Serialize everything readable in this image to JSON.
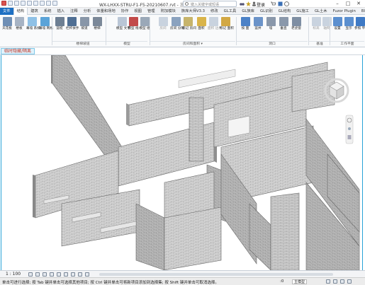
{
  "titlebar": {
    "title": "WX-LHXX-STRU-F1-F5-20210607.rvt - 三维视图: {三维}",
    "search_placeholder": "键入关键字或短语",
    "user": "登录"
  },
  "tabs": [
    "文件",
    "结构",
    "建筑",
    "系统",
    "插入",
    "注释",
    "分析",
    "体量和场地",
    "协作",
    "视图",
    "管理",
    "附加模块",
    "族库大师V3.3",
    "修改",
    "GL工具",
    "GL族库",
    "GL识别",
    "GL结构",
    "GL施工",
    "GL土木",
    "Fuzor Plugin",
    "BIMMAKE"
  ],
  "active_tab": "结构",
  "ribbon": {
    "buttons": [
      {
        "id": "b0",
        "label": "天花板",
        "icon": "ceiling-icon",
        "color": "#6f8fb5"
      },
      {
        "id": "b1",
        "label": "楼板",
        "icon": "floor-icon",
        "color": "#a6b3c4"
      },
      {
        "id": "b2",
        "label": "幕墙 系统",
        "icon": "curtain-system-icon",
        "color": "#8fc1e6"
      },
      {
        "id": "b3",
        "label": "幕墙 网格",
        "icon": "curtain-grid-icon",
        "color": "#5aa3d8"
      },
      {
        "id": "b4",
        "label": "竖梃",
        "icon": "mullion-icon",
        "color": "#6d7f93"
      },
      {
        "id": "b5",
        "label": "栏杆扶手",
        "icon": "railing-icon",
        "color": "#4f6f94"
      },
      {
        "id": "b6",
        "label": "坡道",
        "icon": "ramp-icon",
        "color": "#8896a8"
      },
      {
        "id": "b7",
        "label": "楼梯",
        "icon": "stair-icon",
        "color": "#7b8898"
      },
      {
        "id": "b8",
        "label": "模型 文字",
        "icon": "model-text-icon",
        "color": "#b9c6d6"
      },
      {
        "id": "b9",
        "label": "模型 线",
        "icon": "model-line-icon",
        "color": "#c24a4a"
      },
      {
        "id": "b10",
        "label": "模型 组",
        "icon": "model-group-icon",
        "color": "#9aa8b8"
      },
      {
        "id": "b11",
        "label": "房间",
        "icon": "room-icon",
        "color": "#c9d3df",
        "dis": true
      },
      {
        "id": "b12",
        "label": "房间 分隔",
        "icon": "room-separator-icon",
        "color": "#8aa2bf"
      },
      {
        "id": "b13",
        "label": "标记 房间",
        "icon": "tag-room-icon",
        "color": "#c7b46b"
      },
      {
        "id": "b14",
        "label": "面积",
        "icon": "area-icon",
        "color": "#d9b44a"
      },
      {
        "id": "b15",
        "label": "面积 边界",
        "icon": "area-boundary-icon",
        "color": "#c9d3df",
        "dis": true
      },
      {
        "id": "b16",
        "label": "标记 面积",
        "icon": "tag-area-icon",
        "color": "#d2a844"
      },
      {
        "id": "b17",
        "label": "按 面",
        "icon": "by-face-icon",
        "color": "#4c82c7"
      },
      {
        "id": "b18",
        "label": "竖井",
        "icon": "shaft-icon",
        "color": "#6b93c9"
      },
      {
        "id": "b19",
        "label": "墙",
        "icon": "wall-opening-icon",
        "color": "#8a98ab"
      },
      {
        "id": "b20",
        "label": "垂直",
        "icon": "vertical-opening-icon",
        "color": "#8a98ab"
      },
      {
        "id": "b21",
        "label": "老虎窗",
        "icon": "dormer-icon",
        "color": "#7e8ea3"
      },
      {
        "id": "b22",
        "label": "标高",
        "icon": "level-icon",
        "color": "#c9d3df",
        "dis": true
      },
      {
        "id": "b23",
        "label": "轴网",
        "icon": "grid-icon",
        "color": "#c9d3df",
        "dis": true
      },
      {
        "id": "b24",
        "label": "设置",
        "icon": "set-workplane-icon",
        "color": "#5b8fcf"
      },
      {
        "id": "b25",
        "label": "显示",
        "icon": "show-workplane-icon",
        "color": "#5b8fcf"
      },
      {
        "id": "b26",
        "label": "参照 平面",
        "icon": "ref-plane-icon",
        "color": "#3f7ac5"
      },
      {
        "id": "b27",
        "label": "查看器",
        "icon": "viewer-icon",
        "color": "#6f8ea9"
      }
    ],
    "groups": [
      {
        "label": "楼梯坡道"
      },
      {
        "label": "模型"
      },
      {
        "label": "房间和面积 ▾"
      },
      {
        "label": "洞口"
      },
      {
        "label": "基准"
      },
      {
        "label": "工作平面"
      }
    ]
  },
  "view_tab": "临时隐藏/隔离",
  "view_controls": {
    "scale": "1 : 100"
  },
  "statusbar": {
    "message": "单击可进行选择; 按 Tab 键并单击可选择其他项目; 按 Ctrl 键并单击可将新项目添加到选择集; 按 Shift 键并单击可取消选择。",
    "zero": ":0",
    "model_field": "主模型"
  }
}
